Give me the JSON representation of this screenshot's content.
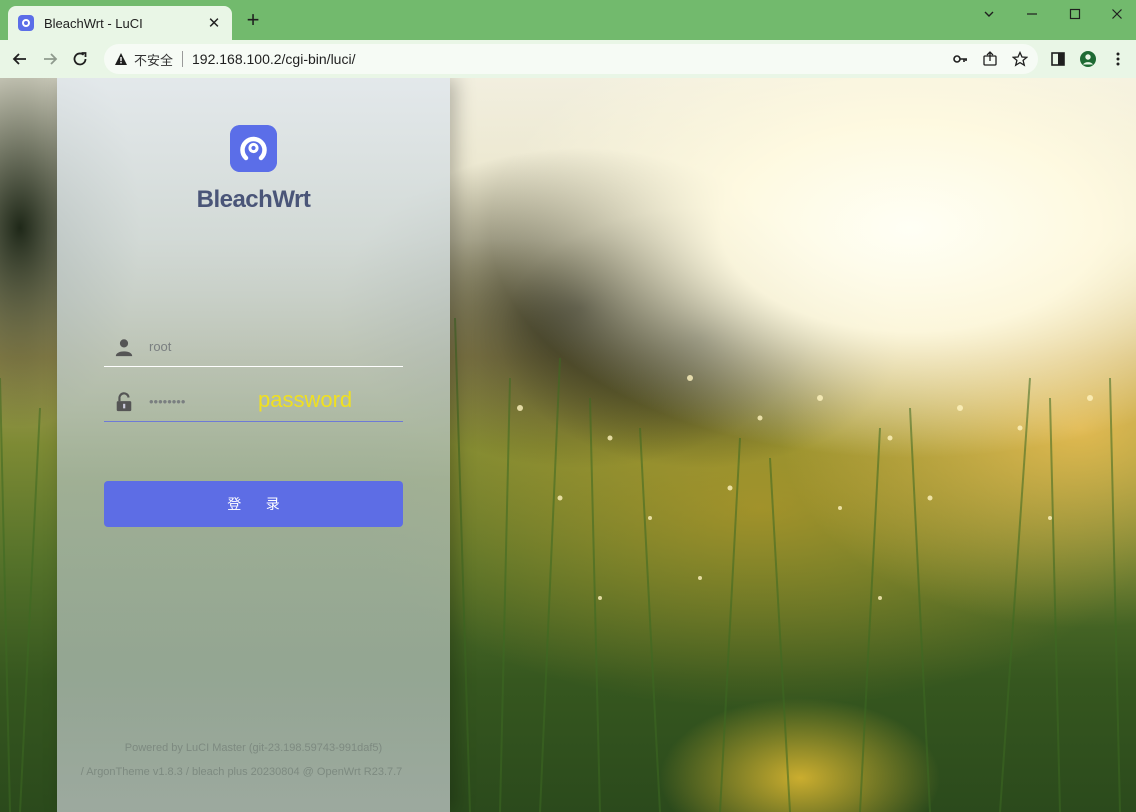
{
  "browser": {
    "tab_title": "BleachWrt - LuCI",
    "tab_close": "✕",
    "new_tab": "+",
    "security_label": "不安全",
    "url": "192.168.100.2/cgi-bin/luci/",
    "theme_color": "#72ba6d"
  },
  "login": {
    "brand": "BleachWrt",
    "username_value": "root",
    "password_value": "••••••••",
    "password_annotation": "password",
    "submit_label": "登 录",
    "accent_color": "#5b6ee8"
  },
  "footer": {
    "line1": "Powered by LuCI Master (git-23.198.59743-991daf5)",
    "line2": "/ ArgonTheme v1.8.3 / bleach plus 20230804 @ OpenWrt R23.7.7"
  }
}
